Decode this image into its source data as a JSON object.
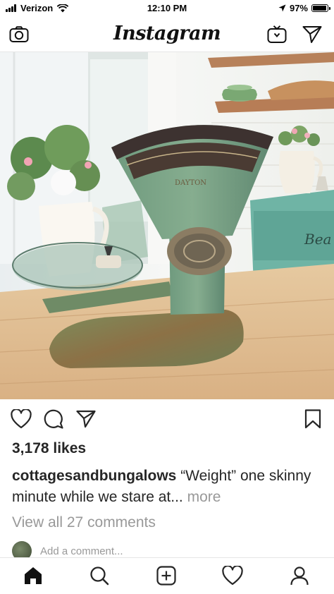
{
  "status_bar": {
    "carrier": "Verizon",
    "time": "12:10 PM",
    "battery": "97%",
    "battery_level": 0.97,
    "icons": [
      "signal-icon",
      "wifi-icon",
      "location-arrow-icon",
      "battery-icon"
    ]
  },
  "header": {
    "logo": "Instagram",
    "icons": [
      "camera-icon",
      "igtv-icon",
      "direct-message-icon"
    ]
  },
  "post": {
    "image_description_icon": "photo",
    "actions": [
      "heart-icon",
      "comment-icon",
      "share-icon",
      "bookmark-icon"
    ],
    "likes": "3,178 likes",
    "caption_user": "cottagesandbungalows",
    "caption_text": " “Weight” one skinny minute while we stare at... ",
    "caption_more": "more",
    "view_comments": "View all 27 comments",
    "add_comment_placeholder": "Add a comment..."
  },
  "tab_bar": {
    "items": [
      "home-icon",
      "search-icon",
      "new-post-icon",
      "activity-heart-icon",
      "profile-icon"
    ]
  }
}
